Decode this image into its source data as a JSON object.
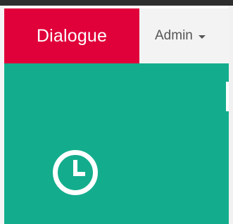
{
  "navbar": {
    "brand_label": "Dialogue",
    "user_menu_label": "Admin",
    "user_menu_caret": "chevron-down-icon"
  },
  "panel": {
    "icon": "clock-icon"
  },
  "colors": {
    "brand_red": "#e0003a",
    "panel_teal": "#13ad8d",
    "navbar_bg": "#f3f3f3",
    "menu_text": "#555555"
  }
}
